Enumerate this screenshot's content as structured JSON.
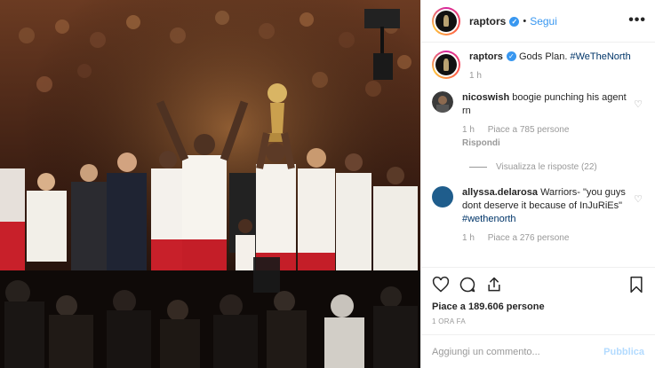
{
  "colors": {
    "accent": "#3897f0",
    "muted": "#999999",
    "border": "#efefef"
  },
  "header": {
    "username": "raptors",
    "dot": "•",
    "follow_label": "Segui",
    "more_label": "•••"
  },
  "caption": {
    "username": "raptors",
    "text": "Gods Plan.",
    "hashtag": "#WeTheNorth",
    "time": "1 h"
  },
  "comments": [
    {
      "username": "nicoswish",
      "text": "boogie punching his agent rn",
      "time": "1 h",
      "likes": "Piace a 785 persone",
      "reply": "Rispondi",
      "view_replies": "Visualizza le risposte (22)"
    },
    {
      "username": "allyssa.delarosa",
      "text": "Warriors- \"you guys dont deserve it because of InJuRiEs\"",
      "hashtag": "#wethenorth",
      "time": "1 h",
      "likes": "Piace a 276 persone"
    }
  ],
  "actions": {
    "like_icon": "heart-icon",
    "comment_icon": "comment-icon",
    "share_icon": "share-icon",
    "save_icon": "bookmark-icon",
    "likes_text": "Piace a 189.606 persone",
    "time_text": "1 ORA FA"
  },
  "add_comment": {
    "placeholder": "Aggiungi un commento...",
    "publish_label": "Pubblica"
  }
}
